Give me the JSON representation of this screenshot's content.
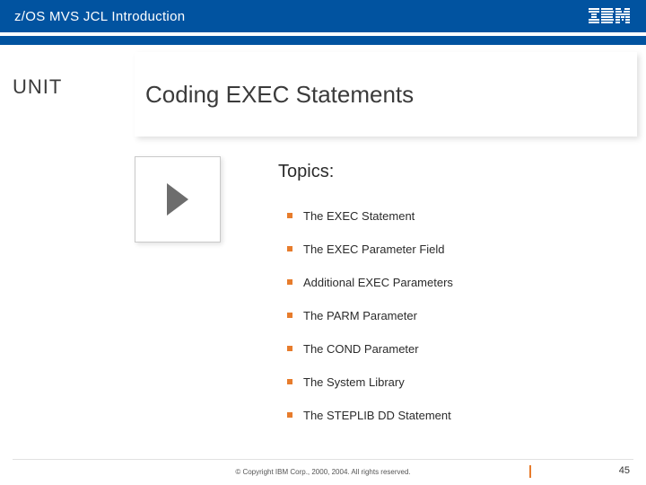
{
  "header": {
    "title": "z/OS MVS JCL Introduction",
    "logo": "IBM"
  },
  "unit_label": "UNIT",
  "page_title": "Coding EXEC Statements",
  "topics_heading": "Topics:",
  "topics": [
    "The EXEC Statement",
    "The EXEC Parameter Field",
    "Additional EXEC Parameters",
    "The PARM Parameter",
    "The COND Parameter",
    "The System Library",
    "The STEPLIB DD Statement"
  ],
  "footer": {
    "copyright": "© Copyright IBM Corp., 2000, 2004. All rights reserved.",
    "page_number": "45"
  }
}
